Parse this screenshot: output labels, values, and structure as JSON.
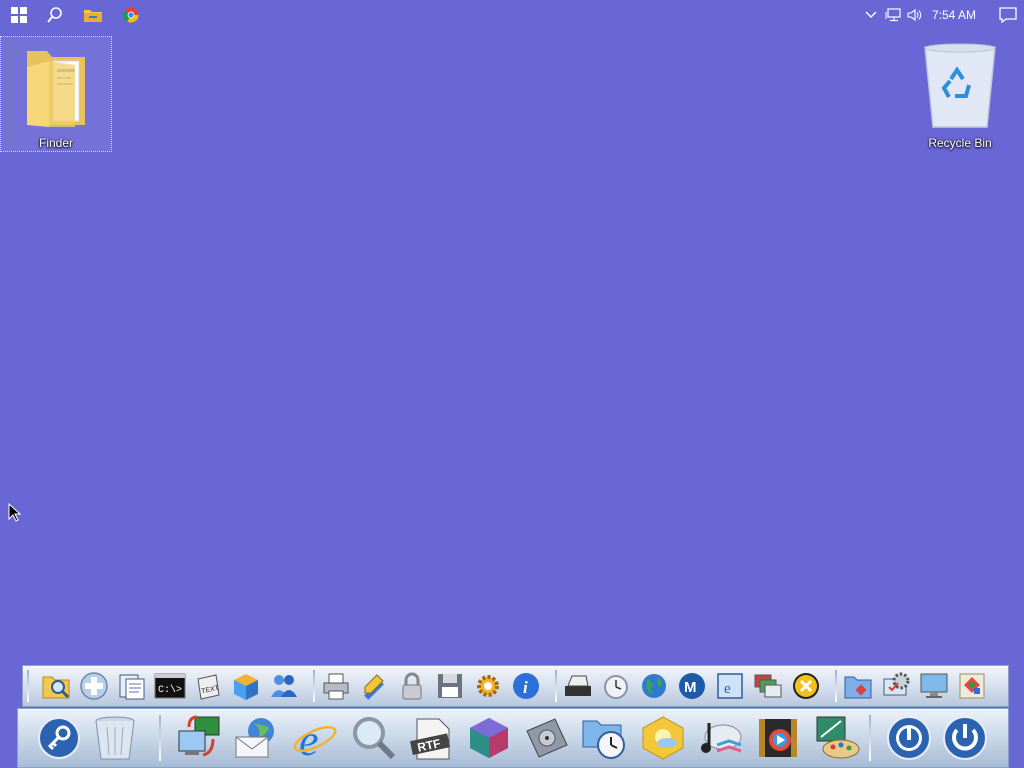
{
  "taskbar": {
    "buttons": [
      {
        "icon": "windows-start-icon"
      },
      {
        "icon": "search-icon"
      },
      {
        "icon": "file-explorer-icon"
      },
      {
        "icon": "chrome-icon"
      }
    ],
    "tray": {
      "icons": [
        "chevron-up-icon",
        "network-icon",
        "volume-icon"
      ],
      "time": "7:54 AM",
      "notification_icon": "action-center-icon"
    }
  },
  "desktop": {
    "icons": [
      {
        "label": "Finder",
        "icon": "folder-icon",
        "selected": true
      },
      {
        "label": "Recycle Bin",
        "icon": "recycle-bin-icon",
        "selected": false
      }
    ]
  },
  "dock_upper": {
    "groups": [
      [
        "folder-search-icon",
        "plus-icon",
        "documents-icon",
        "command-prompt-icon",
        "text-editor-icon",
        "package-icon",
        "network-users-icon"
      ],
      [
        "printer-icon",
        "pencil-ruler-icon",
        "lock-icon",
        "floppy-disk-icon",
        "settings-gear-icon",
        "info-icon"
      ],
      [
        "scanner-icon",
        "clock-icon",
        "globe-icon",
        "mail-m-icon",
        "browser-window-icon",
        "windows-stack-icon",
        "close-x-icon"
      ],
      [
        "folder-tools-icon",
        "system-settings-icon",
        "monitor-icon",
        "paint-icon"
      ]
    ]
  },
  "dock_lower": {
    "groups": [
      [
        "key-icon",
        "trash-icon"
      ],
      [
        "remote-desktop-icon",
        "email-globe-icon",
        "internet-explorer-icon",
        "search-magnifier-icon",
        "rtf-document-icon",
        "3d-cube-icon",
        "disk-utility-icon",
        "time-machine-icon",
        "weather-icon",
        "music-icon",
        "video-player-icon",
        "image-editor-icon"
      ],
      [
        "power-restart-icon",
        "power-off-icon"
      ]
    ]
  },
  "colors": {
    "desktop": "#6967d6",
    "dock_top": "#eef3fa",
    "dock_bottom": "#a8bcd6"
  }
}
